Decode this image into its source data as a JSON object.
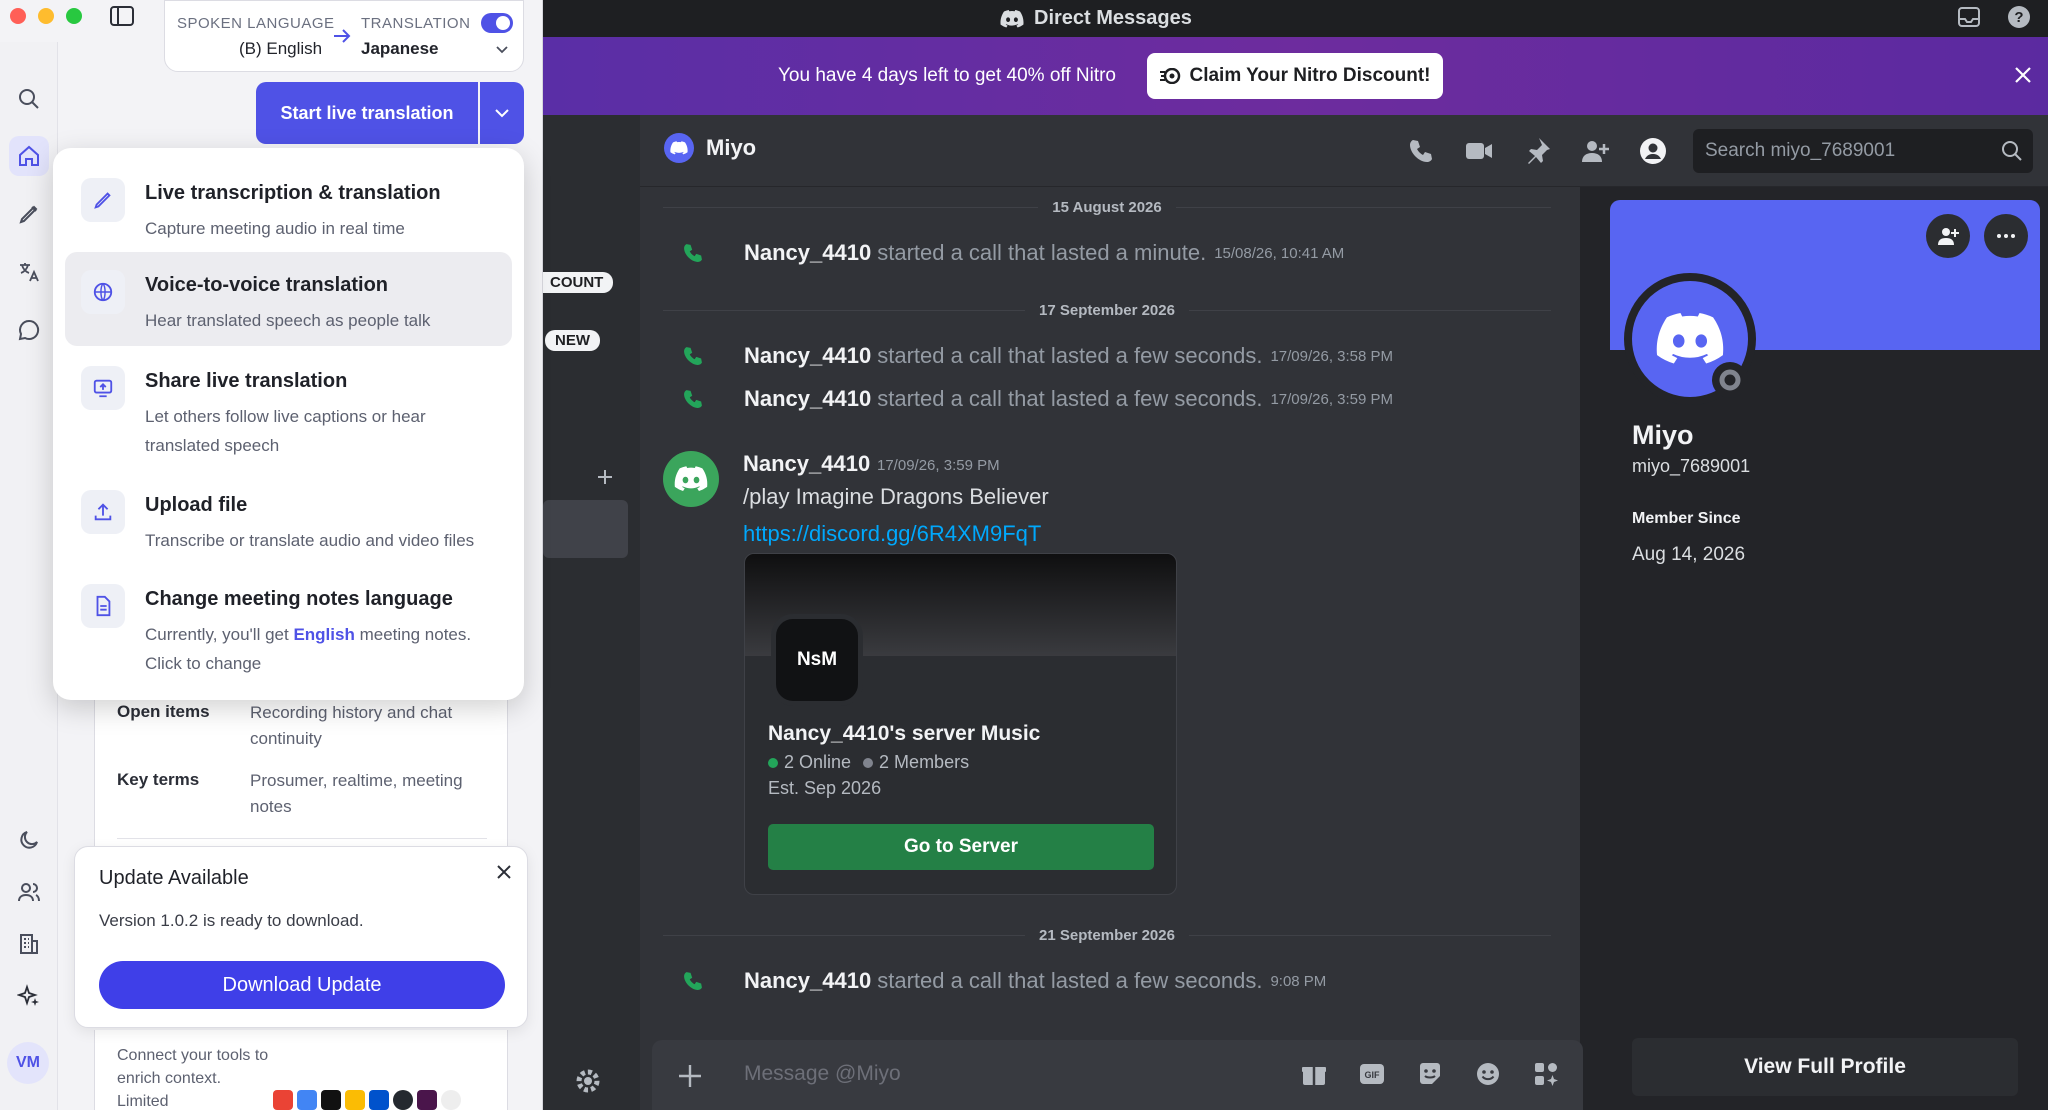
{
  "discord": {
    "window_title": "Direct Messages",
    "nitro": {
      "message": "You have 4 days left to get 40% off Nitro",
      "button": "Claim Your Nitro Discount!"
    },
    "channel_pills": [
      "COUNT",
      "NEW"
    ],
    "dm": {
      "name": "Miyo",
      "search_placeholder": "Search miyo_7689001"
    },
    "messages": {
      "date1": "15 August 2026",
      "call1": {
        "user": "Nancy_4410",
        "text": "started a call that lasted a minute.",
        "time": "15/08/26, 10:41 AM"
      },
      "date2": "17 September 2026",
      "call2": {
        "user": "Nancy_4410",
        "text": "started a call that lasted a few seconds.",
        "time": "17/09/26, 3:58 PM"
      },
      "call3": {
        "user": "Nancy_4410",
        "text": "started a call that lasted a few seconds.",
        "time": "17/09/26, 3:59 PM"
      },
      "post": {
        "user": "Nancy_4410",
        "time": "17/09/26, 3:59 PM",
        "text": "/play Imagine Dragons Believer",
        "link": "https://discord.gg/6R4XM9FqT"
      },
      "invite": {
        "initials": "NsM",
        "server": "Nancy_4410's server Music",
        "online": "2 Online",
        "members": "2 Members",
        "est": "Est. Sep 2026",
        "button": "Go to Server"
      },
      "date3": "21 September 2026",
      "call4": {
        "user": "Nancy_4410",
        "text": "started a call that lasted a few seconds.",
        "time": "9:08 PM"
      }
    },
    "composer_placeholder": "Message @Miyo",
    "profile": {
      "display_name": "Miyo",
      "username": "miyo_7689001",
      "member_since_label": "Member Since",
      "member_since": "Aug 14, 2026",
      "view_button": "View Full Profile"
    },
    "colors": {
      "blurple": "#5865f2",
      "green": "#248046",
      "link": "#00a8fc"
    }
  },
  "translator": {
    "spoken_label": "SPOKEN LANGUAGE",
    "spoken_value": "(B) English",
    "translation_label": "TRANSLATION",
    "translation_value": "Japanese",
    "start_button": "Start live translation",
    "menu": [
      {
        "title": "Live transcription & translation",
        "desc": "Capture meeting audio in real time",
        "icon": "pen-icon"
      },
      {
        "title": "Voice-to-voice translation",
        "desc": "Hear translated speech as people talk",
        "icon": "globe-icon"
      },
      {
        "title": "Share live translation",
        "desc": "Let others follow live captions or hear translated speech",
        "icon": "screen-share-icon"
      },
      {
        "title": "Upload file",
        "desc": "Transcribe or translate audio and video files",
        "icon": "upload-icon"
      },
      {
        "title": "Change meeting notes language",
        "desc_pre": "Currently, you'll get",
        "desc_hl": "English",
        "desc_post": "meeting notes. Click to change",
        "icon": "document-icon"
      }
    ],
    "notes": [
      {
        "key": "Open items",
        "value": "Recording history and chat continuity"
      },
      {
        "key": "Key terms",
        "value": "Prosumer, realtime, meeting notes"
      }
    ],
    "update": {
      "title": "Update Available",
      "desc": "Version 1.0.2 is ready to download.",
      "button": "Download Update"
    },
    "connect_text": "Connect your tools to enrich context. Limited",
    "user_initials": "VM",
    "accent": "#4f52e6"
  }
}
